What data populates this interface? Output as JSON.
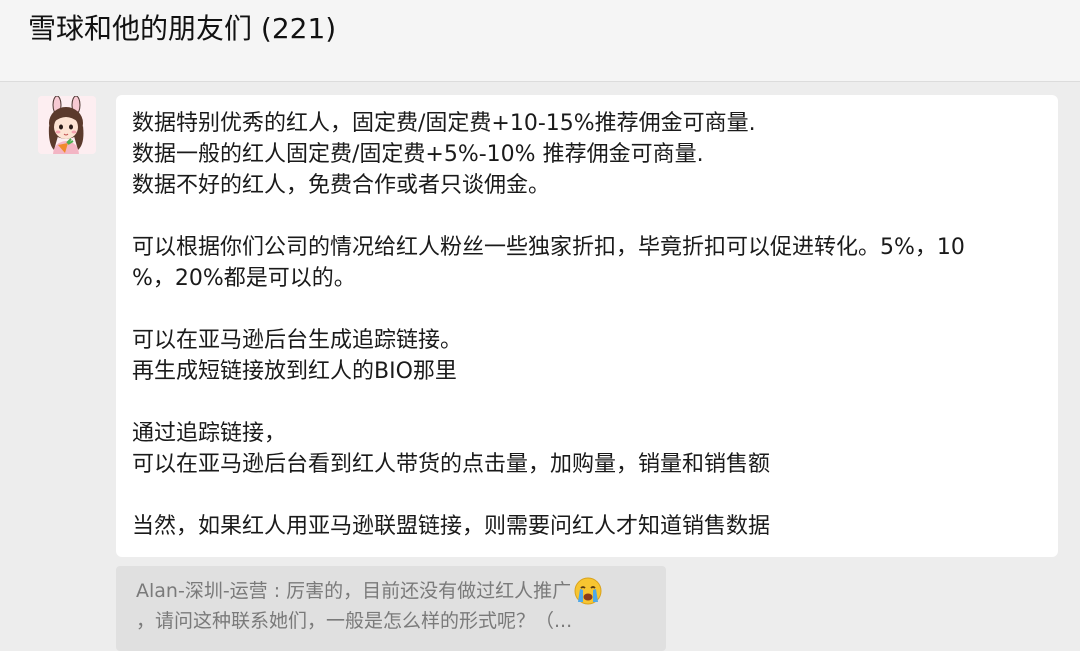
{
  "header": {
    "title": "雪球和他的朋友们 (221)"
  },
  "message": {
    "avatar_icon": "girl-with-carrot-avatar",
    "lines": [
      "数据特别优秀的红人，固定费/固定费+10-15%推荐佣金可商量.",
      "数据一般的红人固定费/固定费+5%-10% 推荐佣金可商量.",
      "数据不好的红人，免费合作或者只谈佣金。",
      "",
      "可以根据你们公司的情况给红人粉丝一些独家折扣，毕竟折扣可以促进转化。5%，10",
      "%，20%都是可以的。",
      "",
      "可以在亚马逊后台生成追踪链接。",
      "再生成短链接放到红人的BIO那里",
      "",
      "通过追踪链接，",
      "可以在亚马逊后台看到红人带货的点击量，加购量，销量和销售额",
      "",
      "当然，如果红人用亚马逊联盟链接，则需要问红人才知道销售数据"
    ]
  },
  "quote": {
    "line1": "Alan-深圳-运营 : 厉害的，目前还没有做过红人推广",
    "line2": "，请问这种联系她们，一般是怎么样的形式呢？（...",
    "emoji_icon": "crying-face-emoji"
  },
  "colors": {
    "background": "#ededed",
    "bubble": "#ffffff",
    "quote_bg": "#e0e0e0",
    "text": "#1a1a1a",
    "quote_text": "#7a7a7a"
  }
}
